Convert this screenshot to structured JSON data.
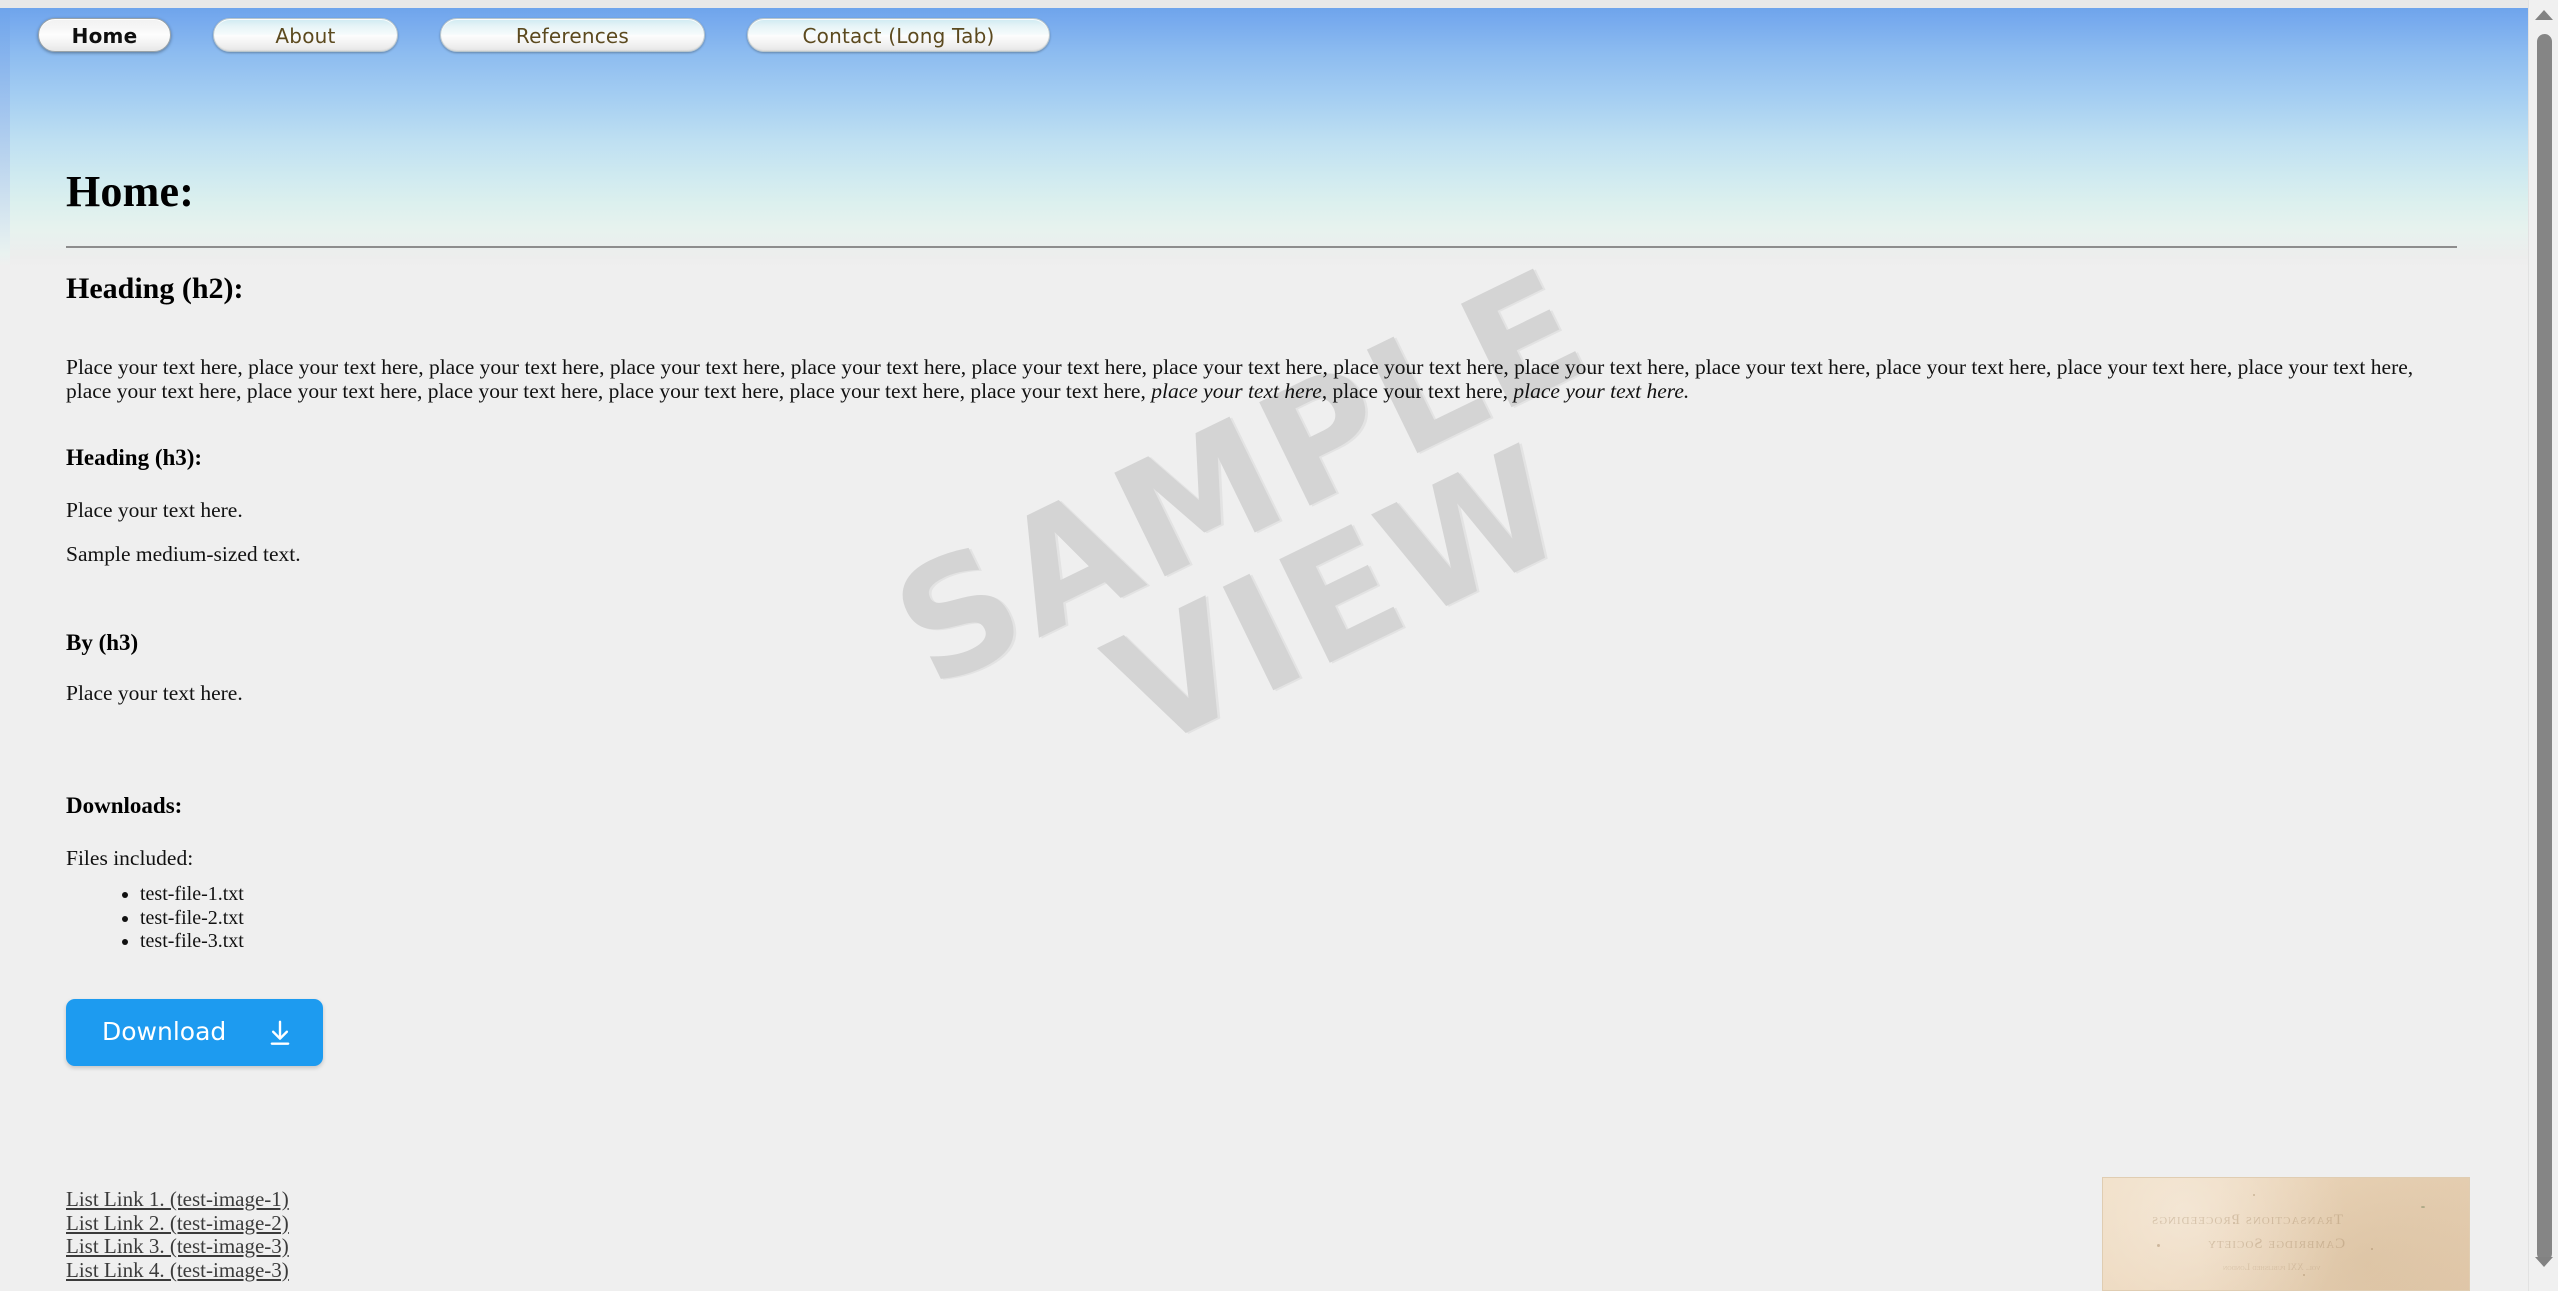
{
  "tabs": [
    {
      "label": "Home",
      "active": true,
      "width_class": "tab-w1"
    },
    {
      "label": "About",
      "active": false,
      "width_class": "tab-w2"
    },
    {
      "label": "References",
      "active": false,
      "width_class": "tab-w3"
    },
    {
      "label": "Contact (Long Tab)",
      "active": false,
      "width_class": "tab-w4"
    }
  ],
  "page": {
    "title": "Home:",
    "h2": "Heading (h2):",
    "paragraph_parts": [
      {
        "text": "Place your text here, place your text here, place your text here, place your text here, place your text here, place your text here, place your text here, place your text here, place your text here, place your text here, place your text here, place your text here, place your text here, place your text here, place your text here, place your text here, place your text here, place your text here, place your text here, ",
        "italic": false
      },
      {
        "text": "place your text here,",
        "italic": true
      },
      {
        "text": " place your text here, ",
        "italic": false
      },
      {
        "text": "place your text here.",
        "italic": true
      }
    ],
    "h3_heading": "Heading (h3):",
    "h3_paragraph": "Place your text here.",
    "medium_text": "Sample medium-sized text.",
    "by_heading": "By (h3)",
    "by_paragraph": "Place your text here.",
    "downloads_heading": "Downloads:",
    "files_included_label": "Files included:",
    "files": [
      "test-file-1.txt",
      "test-file-2.txt",
      "test-file-3.txt"
    ],
    "download_button_label": "Download",
    "download_icon": "download-arrow-icon",
    "links": [
      "List Link 1. (test-image-1)",
      "List Link 2. (test-image-2)",
      "List Link 3. (test-image-3)",
      "List Link 4. (test-image-3)"
    ]
  },
  "watermark": {
    "line1": "SAMPLE",
    "line2": "VIEW"
  },
  "scan_image": {
    "line1": "Transactions    Proceedings",
    "line2": "Cambridge Society",
    "line3": "vol. XXI  published  London"
  },
  "scrollbar": {
    "up_icon": "chevron-up-icon",
    "down_icon": "chevron-down-icon"
  },
  "colors": {
    "accent_blue": "#1d9bf0",
    "sky_top": "#6ea4ec",
    "sky_bottom": "#efefef",
    "page_bg": "#efefef",
    "tab_text": "#5c4a1f",
    "link_text": "#3b3b3b",
    "watermark": "#d4d4d4"
  }
}
